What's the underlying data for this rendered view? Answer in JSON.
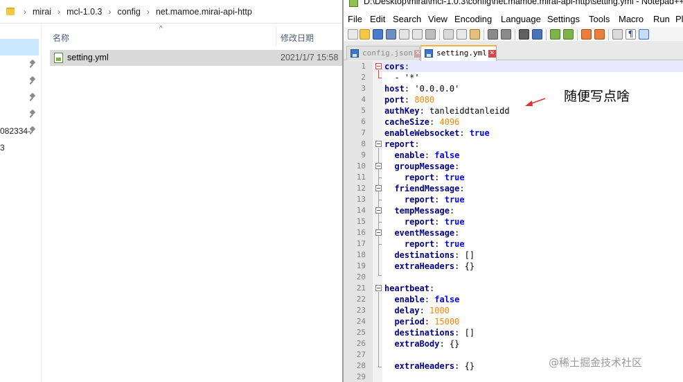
{
  "explorer": {
    "breadcrumb": [
      "mirai",
      "mcl-1.0.3",
      "config",
      "net.mamoe.mirai-api-http"
    ],
    "nav_items": [
      "",
      "",
      "",
      "",
      "",
      "082334-",
      "3"
    ],
    "columns": {
      "name": "名称",
      "date": "修改日期"
    },
    "file": {
      "name": "setting.yml",
      "date": "2021/1/7 15:58"
    }
  },
  "notepad": {
    "title": "D:\\Desktop\\mirai\\mcl-1.0.3\\config\\net.mamoe.mirai-api-http\\setting.yml - Notepad++",
    "menu": [
      "File",
      "Edit",
      "Search",
      "View",
      "Encoding",
      "Language",
      "Settings",
      "Tools",
      "Macro",
      "Run",
      "Pl"
    ],
    "tabs": [
      {
        "label": "config.json",
        "active": false
      },
      {
        "label": "setting.yml",
        "active": true
      }
    ],
    "lines": [
      {
        "n": "1",
        "tokens": [
          [
            "k",
            "cors"
          ],
          [
            "p",
            ":"
          ]
        ]
      },
      {
        "n": "2",
        "tokens": [
          [
            "p",
            "  - '*'"
          ]
        ]
      },
      {
        "n": "3",
        "tokens": [
          [
            "k",
            "host"
          ],
          [
            "p",
            ": "
          ],
          [
            "s",
            "'0.0.0.0'"
          ]
        ]
      },
      {
        "n": "4",
        "tokens": [
          [
            "k",
            "port"
          ],
          [
            "p",
            ": "
          ],
          [
            "n",
            "8080"
          ]
        ]
      },
      {
        "n": "5",
        "tokens": [
          [
            "k",
            "authKey"
          ],
          [
            "p",
            ": "
          ],
          [
            "s",
            "tanleiddtanleidd"
          ]
        ]
      },
      {
        "n": "6",
        "tokens": [
          [
            "k",
            "cacheSize"
          ],
          [
            "p",
            ": "
          ],
          [
            "n",
            "4096"
          ]
        ]
      },
      {
        "n": "7",
        "tokens": [
          [
            "k",
            "enableWebsocket"
          ],
          [
            "p",
            ": "
          ],
          [
            "b",
            "true"
          ]
        ]
      },
      {
        "n": "8",
        "tokens": [
          [
            "k",
            "report"
          ],
          [
            "p",
            ":"
          ]
        ]
      },
      {
        "n": "9",
        "tokens": [
          [
            "p",
            "  "
          ],
          [
            "k",
            "enable"
          ],
          [
            "p",
            ": "
          ],
          [
            "b",
            "false"
          ]
        ]
      },
      {
        "n": "10",
        "tokens": [
          [
            "p",
            "  "
          ],
          [
            "k",
            "groupMessage"
          ],
          [
            "p",
            ":"
          ]
        ]
      },
      {
        "n": "11",
        "tokens": [
          [
            "p",
            "    "
          ],
          [
            "k",
            "report"
          ],
          [
            "p",
            ": "
          ],
          [
            "b",
            "true"
          ]
        ]
      },
      {
        "n": "12",
        "tokens": [
          [
            "p",
            "  "
          ],
          [
            "k",
            "friendMessage"
          ],
          [
            "p",
            ":"
          ]
        ]
      },
      {
        "n": "13",
        "tokens": [
          [
            "p",
            "    "
          ],
          [
            "k",
            "report"
          ],
          [
            "p",
            ": "
          ],
          [
            "b",
            "true"
          ]
        ]
      },
      {
        "n": "14",
        "tokens": [
          [
            "p",
            "  "
          ],
          [
            "k",
            "tempMessage"
          ],
          [
            "p",
            ":"
          ]
        ]
      },
      {
        "n": "15",
        "tokens": [
          [
            "p",
            "    "
          ],
          [
            "k",
            "report"
          ],
          [
            "p",
            ": "
          ],
          [
            "b",
            "true"
          ]
        ]
      },
      {
        "n": "16",
        "tokens": [
          [
            "p",
            "  "
          ],
          [
            "k",
            "eventMessage"
          ],
          [
            "p",
            ":"
          ]
        ]
      },
      {
        "n": "17",
        "tokens": [
          [
            "p",
            "    "
          ],
          [
            "k",
            "report"
          ],
          [
            "p",
            ": "
          ],
          [
            "b",
            "true"
          ]
        ]
      },
      {
        "n": "18",
        "tokens": [
          [
            "p",
            "  "
          ],
          [
            "k",
            "destinations"
          ],
          [
            "p",
            ": []"
          ]
        ]
      },
      {
        "n": "19",
        "tokens": [
          [
            "p",
            "  "
          ],
          [
            "k",
            "extraHeaders"
          ],
          [
            "p",
            ": {}"
          ]
        ]
      },
      {
        "n": "20",
        "tokens": []
      },
      {
        "n": "21",
        "tokens": [
          [
            "k",
            "heartbeat"
          ],
          [
            "p",
            ":"
          ]
        ]
      },
      {
        "n": "22",
        "tokens": [
          [
            "p",
            "  "
          ],
          [
            "k",
            "enable"
          ],
          [
            "p",
            ": "
          ],
          [
            "b",
            "false"
          ]
        ]
      },
      {
        "n": "23",
        "tokens": [
          [
            "p",
            "  "
          ],
          [
            "k",
            "delay"
          ],
          [
            "p",
            ": "
          ],
          [
            "n",
            "1000"
          ]
        ]
      },
      {
        "n": "24",
        "tokens": [
          [
            "p",
            "  "
          ],
          [
            "k",
            "period"
          ],
          [
            "p",
            ": "
          ],
          [
            "n",
            "15000"
          ]
        ]
      },
      {
        "n": "25",
        "tokens": [
          [
            "p",
            "  "
          ],
          [
            "k",
            "destinations"
          ],
          [
            "p",
            ": []"
          ]
        ]
      },
      {
        "n": "26",
        "tokens": [
          [
            "p",
            "  "
          ],
          [
            "k",
            "extraBody"
          ],
          [
            "p",
            ": {}"
          ]
        ]
      },
      {
        "n": "27",
        "tokens": []
      },
      {
        "n": "28",
        "tokens": [
          [
            "p",
            "  "
          ],
          [
            "k",
            "extraHeaders"
          ],
          [
            "p",
            ": {}"
          ]
        ]
      },
      {
        "n": "29",
        "tokens": []
      }
    ]
  },
  "annotation": {
    "text": "随便写点啥",
    "arrow_color": "#e53030"
  },
  "watermark": "@稀土掘金技术社区",
  "colors": {
    "keyword": "#000080",
    "boolean": "#0000ff",
    "number": "#ff8000",
    "fold_marker": "#e84040",
    "tab_accent": "#f7b23a",
    "selection": "#cce8ff"
  }
}
